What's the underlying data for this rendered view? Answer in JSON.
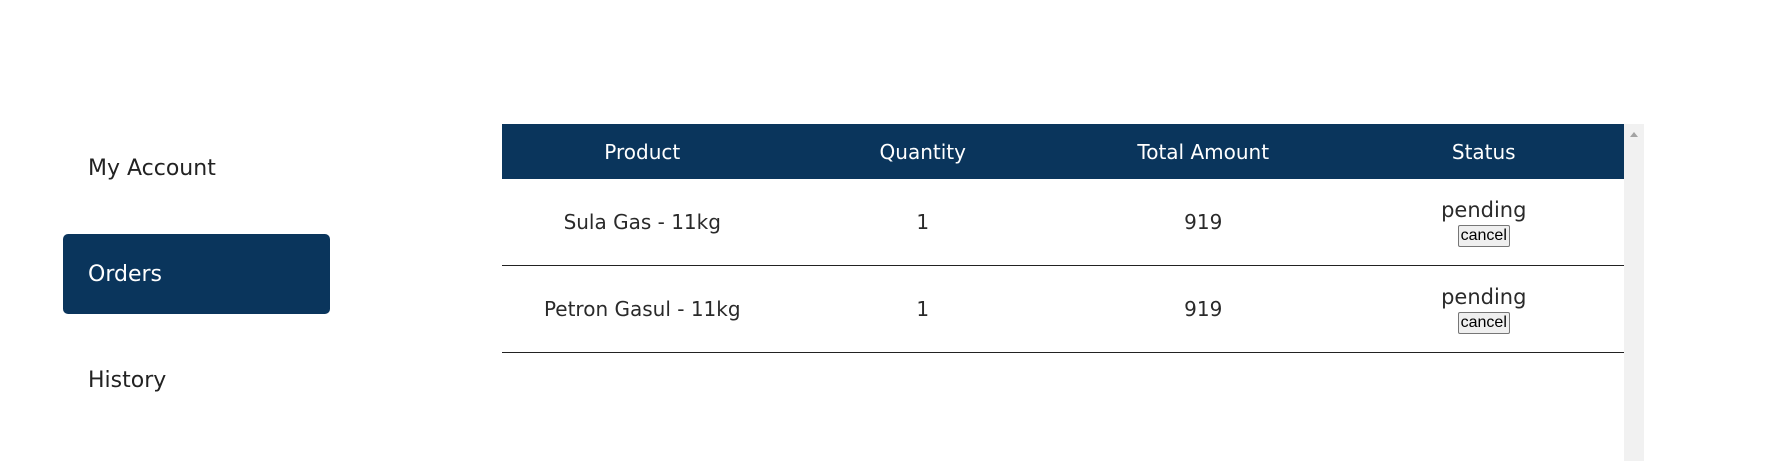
{
  "sidebar": {
    "items": [
      {
        "label": "My Account"
      },
      {
        "label": "Orders",
        "active": true
      },
      {
        "label": "History"
      }
    ]
  },
  "orders_table": {
    "headers": [
      "Product",
      "Quantity",
      "Total Amount",
      "Status"
    ],
    "rows": [
      {
        "product": "Sula Gas - 11kg",
        "quantity": "1",
        "total": "919",
        "status": "pending",
        "action": "cancel"
      },
      {
        "product": "Petron Gasul - 11kg",
        "quantity": "1",
        "total": "919",
        "status": "pending",
        "action": "cancel"
      }
    ]
  },
  "colors": {
    "brand": "#0a355c",
    "text": "#222222",
    "background": "#ffffff"
  },
  "icons": {
    "scroll_up": "scroll-up-arrow-icon"
  }
}
